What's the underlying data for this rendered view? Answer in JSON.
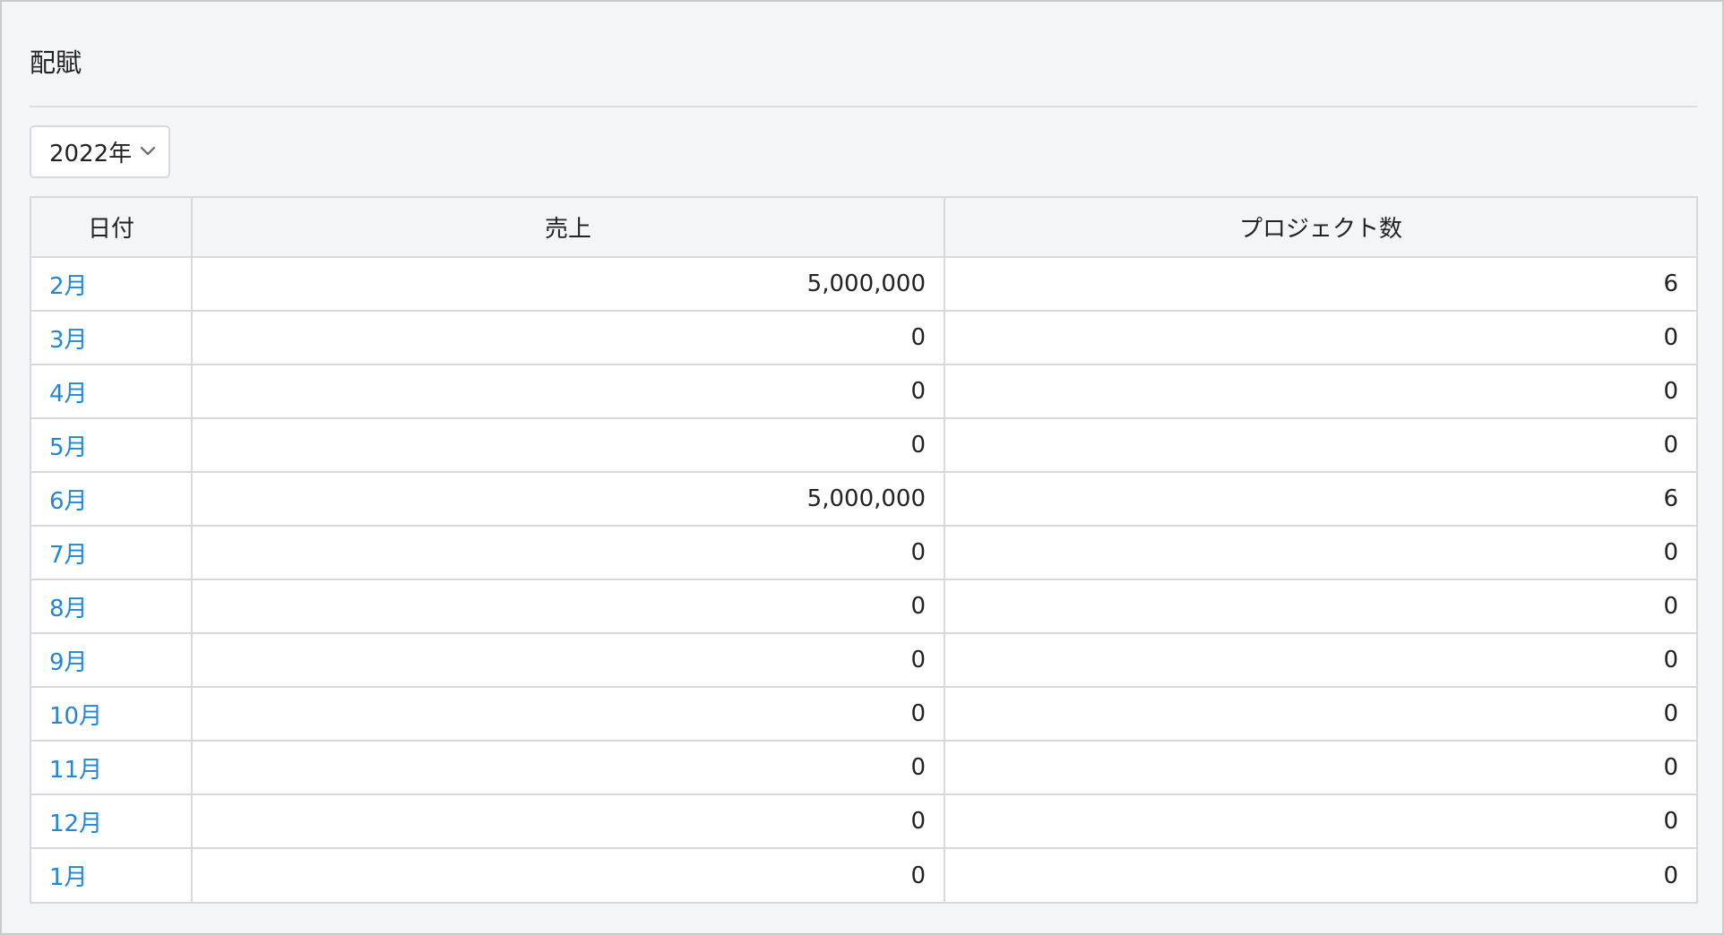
{
  "page": {
    "title": "配賦"
  },
  "filter": {
    "year_selected": "2022年"
  },
  "table": {
    "headers": [
      "日付",
      "売上",
      "プロジェクト数"
    ],
    "rows": [
      {
        "month": "2月",
        "sales": "5,000,000",
        "projects": "6"
      },
      {
        "month": "3月",
        "sales": "0",
        "projects": "0"
      },
      {
        "month": "4月",
        "sales": "0",
        "projects": "0"
      },
      {
        "month": "5月",
        "sales": "0",
        "projects": "0"
      },
      {
        "month": "6月",
        "sales": "5,000,000",
        "projects": "6"
      },
      {
        "month": "7月",
        "sales": "0",
        "projects": "0"
      },
      {
        "month": "8月",
        "sales": "0",
        "projects": "0"
      },
      {
        "month": "9月",
        "sales": "0",
        "projects": "0"
      },
      {
        "month": "10月",
        "sales": "0",
        "projects": "0"
      },
      {
        "month": "11月",
        "sales": "0",
        "projects": "0"
      },
      {
        "month": "12月",
        "sales": "0",
        "projects": "0"
      },
      {
        "month": "1月",
        "sales": "0",
        "projects": "0"
      }
    ]
  },
  "colors": {
    "link": "#1f86d8",
    "border": "#d6d9dd",
    "background": "#f4f5f7"
  },
  "icons": {
    "select_chevron": "chevron-down-icon"
  }
}
